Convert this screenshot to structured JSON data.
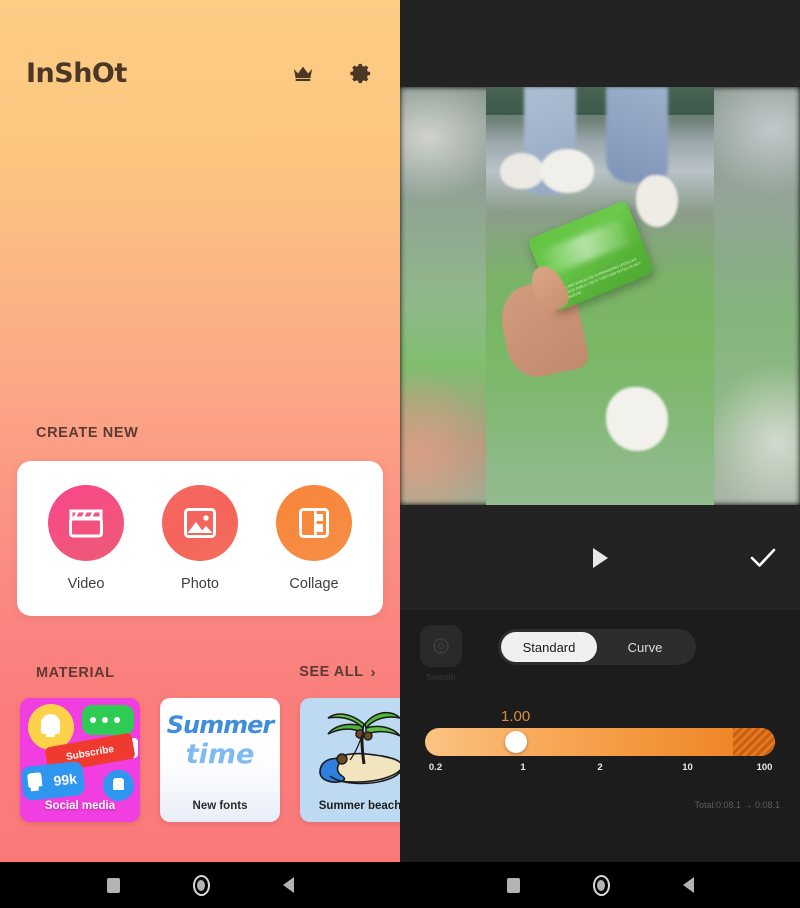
{
  "app": {
    "brand": "InShOt",
    "crown_icon": "crown-icon",
    "gear_icon": "gear-icon"
  },
  "home": {
    "create_section": {
      "label": "CREATE NEW",
      "items": [
        {
          "label": "Video",
          "icon": "clapperboard-icon",
          "color": "#f3517f"
        },
        {
          "label": "Photo",
          "icon": "image-icon",
          "color": "#f4645c"
        },
        {
          "label": "Collage",
          "icon": "collage-icon",
          "color": "#f7893f"
        }
      ]
    },
    "material_section": {
      "label": "MATERIAL",
      "see_all": "SEE ALL",
      "see_all_chevron": "›",
      "items": [
        {
          "title": "Social media",
          "badge": "Subscribe",
          "count": "99k"
        },
        {
          "title": "New fonts",
          "art_line1": "Summer",
          "art_line2": "time"
        },
        {
          "title": "Summer beach"
        }
      ]
    }
  },
  "editor": {
    "play_icon": "play-icon",
    "confirm_icon": "check-icon",
    "speed_tool": {
      "icon": "speed-icon",
      "label": "Smooth"
    },
    "mode_tabs": [
      {
        "label": "Standard",
        "active": true
      },
      {
        "label": "Curve",
        "active": false
      }
    ],
    "speed": {
      "value": "1.00",
      "accent_color": "#e08a3c",
      "ticks": [
        "0.2",
        "1",
        "2",
        "10",
        "100"
      ],
      "tick_positions": [
        3,
        28,
        50,
        75,
        97
      ],
      "knob_percent": 26
    },
    "duration": "Total:0:08.1  →  0:08.1",
    "video_card_text": "THIS CARD SHOULD BE SURRENDERED UPON EXIT BENGKOK PUBLIC USE IF THIS CARD NOTES DO NOT BE MALFUNC"
  },
  "navbar": {
    "buttons": [
      "recents-button",
      "home-button",
      "back-button"
    ]
  }
}
